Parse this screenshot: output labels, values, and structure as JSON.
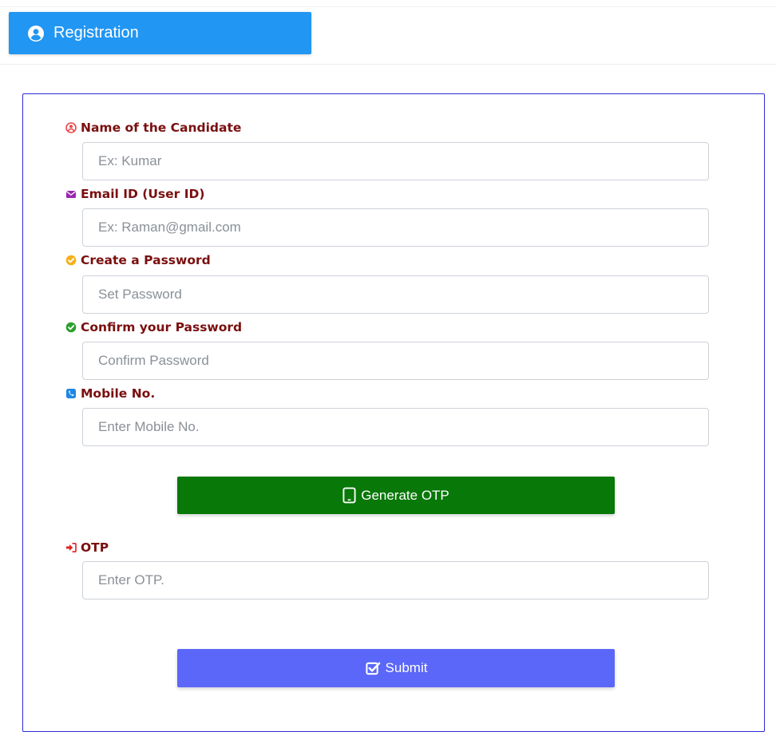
{
  "header": {
    "tab_label": "Registration",
    "tab_icon": "user-circle-icon",
    "tab_color": "#2196f3"
  },
  "form": {
    "border_color": "#2b2bd9",
    "label_color": "#7a0f0f",
    "fields": [
      {
        "label": "Name of the Candidate",
        "placeholder": "Ex: Kumar",
        "value": "",
        "icon": "user-icon",
        "icon_color": "#e8474c"
      },
      {
        "label": "Email ID (User ID)",
        "placeholder": "Ex: Raman@gmail.com",
        "value": "",
        "icon": "envelope-icon",
        "icon_color": "#9b27b0"
      },
      {
        "label": "Create a Password",
        "placeholder": "Set Password",
        "value": "",
        "icon": "check-circle-icon",
        "icon_color": "#f5b01a"
      },
      {
        "label": "Confirm your Password",
        "placeholder": "Confirm Password",
        "value": "",
        "icon": "check-circle-icon",
        "icon_color": "#2ca02c"
      },
      {
        "label": "Mobile No.",
        "placeholder": "Enter Mobile No.",
        "value": "",
        "icon": "phone-square-icon",
        "icon_color": "#1e88e5"
      }
    ],
    "generate_otp": {
      "label": "Generate OTP",
      "icon": "mobile-icon",
      "color": "#087808"
    },
    "otp": {
      "label": "OTP",
      "placeholder": "Enter OTP.",
      "value": "",
      "icon": "sign-in-icon",
      "icon_color": "#e02020"
    },
    "submit": {
      "label": "Submit",
      "icon": "check-square-icon",
      "color": "#5b67f8"
    }
  }
}
